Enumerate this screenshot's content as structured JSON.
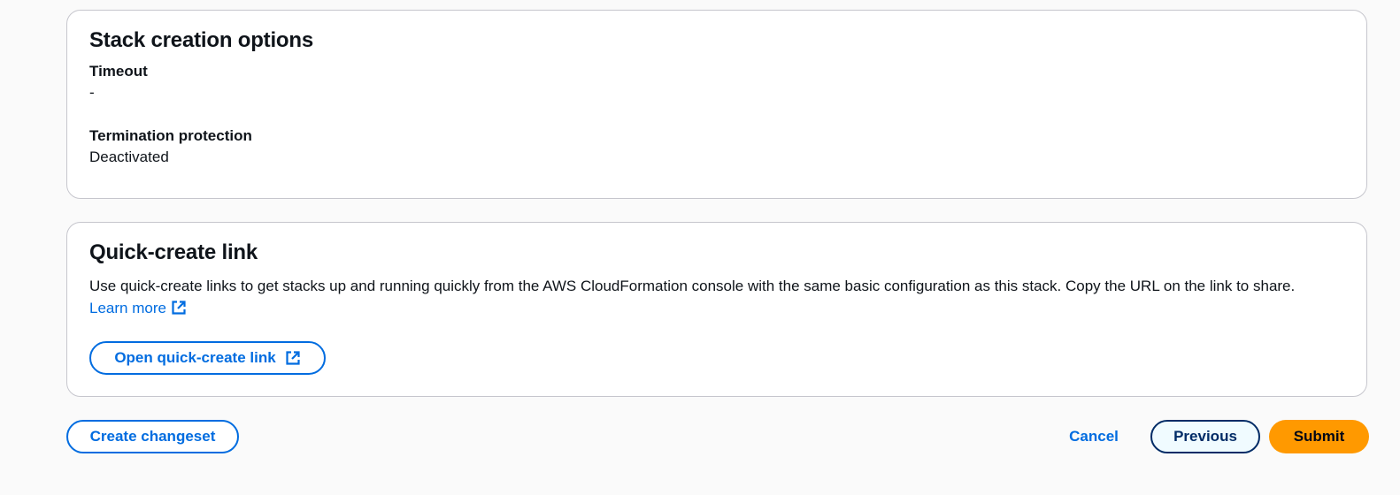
{
  "stack_creation": {
    "title": "Stack creation options",
    "timeout_label": "Timeout",
    "timeout_value": "-",
    "termination_label": "Termination protection",
    "termination_value": "Deactivated"
  },
  "quick_create": {
    "title": "Quick-create link",
    "description": "Use quick-create links to get stacks up and running quickly from the AWS CloudFormation console with the same basic configuration as this stack. Copy the URL on the link to share.",
    "learn_more_label": "Learn more",
    "open_link_label": "Open quick-create link",
    "external_icon": "external-link-icon"
  },
  "footer": {
    "create_changeset_label": "Create changeset",
    "cancel_label": "Cancel",
    "previous_label": "Previous",
    "submit_label": "Submit"
  },
  "colors": {
    "link": "#006ce0",
    "submit_bg": "#ff9900",
    "previous_border": "#002b66",
    "card_border": "#c6c6cd"
  }
}
